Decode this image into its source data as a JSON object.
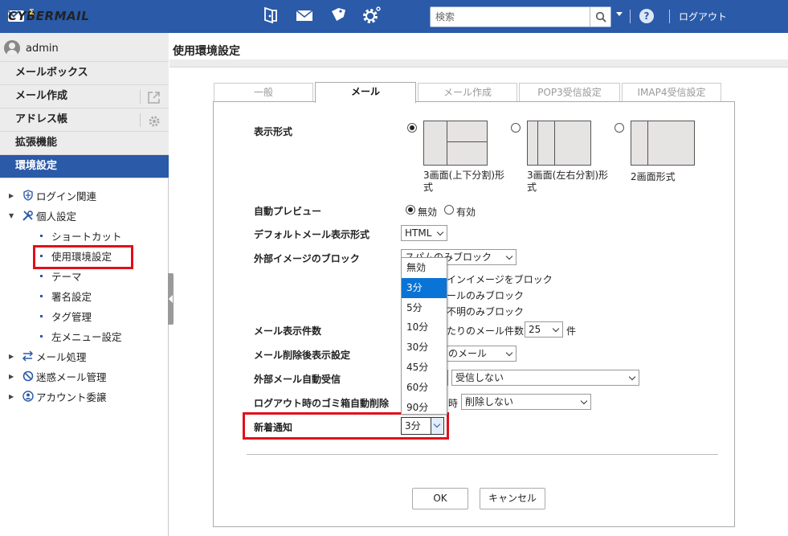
{
  "header": {
    "logo_text": "CYBERMAIL",
    "logo_mark": "Σ",
    "search_placeholder": "検索",
    "logout_label": "ログアウト",
    "help_label": "?",
    "icons": [
      "portal-icon",
      "mail-icon",
      "tag-icon",
      "settings-gear-icon"
    ]
  },
  "sidebar": {
    "username": "admin",
    "menu": [
      {
        "label": "メールボックス"
      },
      {
        "label": "メール作成"
      },
      {
        "label": "アドレス帳"
      },
      {
        "label": "拡張機能"
      },
      {
        "label": "環境設定"
      }
    ],
    "tree": {
      "login": "ログイン関連",
      "personal": "個人設定",
      "children": [
        "ショートカット",
        "使用環境設定",
        "テーマ",
        "署名設定",
        "タグ管理",
        "左メニュー設定"
      ],
      "mail_processing": "メール処理",
      "spam": "迷惑メール管理",
      "account": "アカウント委譲"
    }
  },
  "main": {
    "page_title": "使用環境設定",
    "tabs": [
      "一般",
      "メール",
      "メール作成",
      "POP3受信設定",
      "IMAP4受信設定"
    ],
    "display_format": {
      "label": "表示形式",
      "option1": "3画面(上下分割)形式",
      "option2": "3画面(左右分割)形式",
      "option3": "2画面形式"
    },
    "auto_preview": {
      "label": "自動プレビュー",
      "off": "無効",
      "on": "有効"
    },
    "default_format": {
      "label": "デフォルトメール表示形式",
      "value": "HTML"
    },
    "external_image": {
      "label": "外部イメージのブロック",
      "value": "スパムのみブロック",
      "line1": "インイメージをブロック",
      "line2": "ールのみブロック",
      "line3": "不明のみブロック"
    },
    "mail_count": {
      "label": "メール表示件数",
      "text": "たりのメール件数",
      "value": "25",
      "unit": "件"
    },
    "after_delete": {
      "label": "メール削除後表示設定",
      "value": "のメール"
    },
    "external_receive": {
      "label": "外部メール自動受信",
      "value": "受信しない"
    },
    "trash_delete": {
      "label": "ログアウト時のゴミ箱自動削除",
      "time_suffix": "時",
      "value": "削除しない"
    },
    "new_mail": {
      "label": "新着通知",
      "value": "3分"
    },
    "dropdown_options": [
      "無効",
      "3分",
      "5分",
      "10分",
      "30分",
      "45分",
      "60分",
      "90分"
    ],
    "dropdown_selected_index": 1,
    "ok_label": "OK",
    "cancel_label": "キャンセル"
  },
  "colors": {
    "header_bg": "#2a5aa8",
    "highlight": "#e10f1a",
    "dropdown_selected": "#0a74d6"
  }
}
